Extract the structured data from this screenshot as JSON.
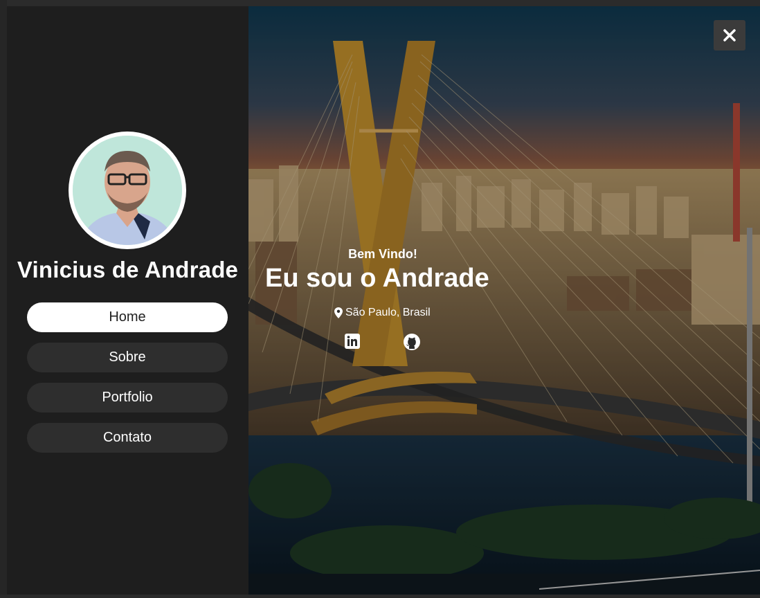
{
  "profile": {
    "name": "Vinicius de Andrade"
  },
  "nav": {
    "items": [
      {
        "label": "Home",
        "active": true
      },
      {
        "label": "Sobre",
        "active": false
      },
      {
        "label": "Portfolio",
        "active": false
      },
      {
        "label": "Contato",
        "active": false
      }
    ]
  },
  "hero": {
    "greeting": "Bem Vindo!",
    "headline": "Eu sou o Andrade",
    "location": "São Paulo, Brasil",
    "social": [
      "linkedin-icon",
      "github-icon"
    ]
  },
  "colors": {
    "sidebar_bg": "#1e1e1e",
    "nav_button_bg": "#2e2e2e",
    "active_button_bg": "#ffffff",
    "close_button_bg": "#3b3b3b"
  }
}
